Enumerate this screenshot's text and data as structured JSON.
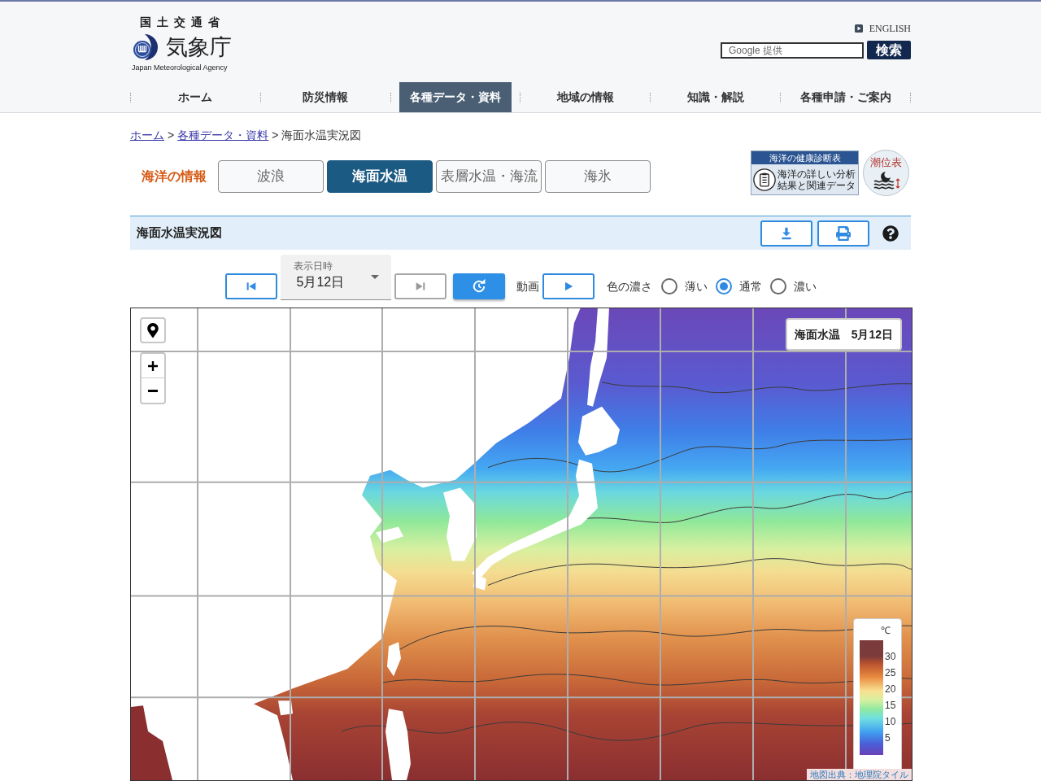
{
  "header": {
    "ministry": "国土交通省",
    "agency": "気象庁",
    "agency_en": "Japan Meteorological Agency",
    "english_link": "ENGLISH",
    "search": {
      "placeholder": "Google 提供",
      "button": "検索"
    }
  },
  "nav": [
    {
      "label": "ホーム",
      "selected": false
    },
    {
      "label": "防災情報",
      "selected": false
    },
    {
      "label": "各種データ・資料",
      "selected": true
    },
    {
      "label": "地域の情報",
      "selected": false
    },
    {
      "label": "知識・解説",
      "selected": false
    },
    {
      "label": "各種申請・ご案内",
      "selected": false
    }
  ],
  "breadcrumb": [
    {
      "kind": "link",
      "label": "ホーム"
    },
    {
      "kind": "separator",
      "label": ">"
    },
    {
      "kind": "link",
      "label": "各種データ・資料"
    },
    {
      "kind": "separator",
      "label": ">"
    },
    {
      "kind": "current",
      "label": "海面水温実況図"
    }
  ],
  "ocean_info": {
    "label": "海洋の情報",
    "tabs": [
      {
        "label": "波浪",
        "selected": false
      },
      {
        "label": "海面水温",
        "selected": true
      },
      {
        "label": "表層水温・海流",
        "selected": false
      },
      {
        "label": "海氷",
        "selected": false
      }
    ],
    "health_banner": {
      "title": "海洋の健康診断表",
      "lines": [
        "海洋の詳しい分析",
        "結果と関連データ"
      ]
    },
    "tide_link": "潮位表"
  },
  "panel": {
    "title": "海面水温実況図"
  },
  "controls": {
    "first_button": {
      "disabled": false
    },
    "date": {
      "label": "表示日時",
      "value": "5月12日"
    },
    "last_button": {
      "disabled": true
    },
    "animation_label": "動画",
    "color_density": {
      "label": "色の濃さ",
      "options": [
        {
          "label": "薄い",
          "selected": false
        },
        {
          "label": "通常",
          "selected": true
        },
        {
          "label": "濃い",
          "selected": false
        }
      ]
    }
  },
  "map": {
    "title": "海面水温　5月12日",
    "legend": {
      "unit": "℃",
      "ticks": [
        "30",
        "25",
        "20",
        "15",
        "10",
        "5"
      ]
    },
    "attribution": "地図出典：地理院タイル"
  }
}
